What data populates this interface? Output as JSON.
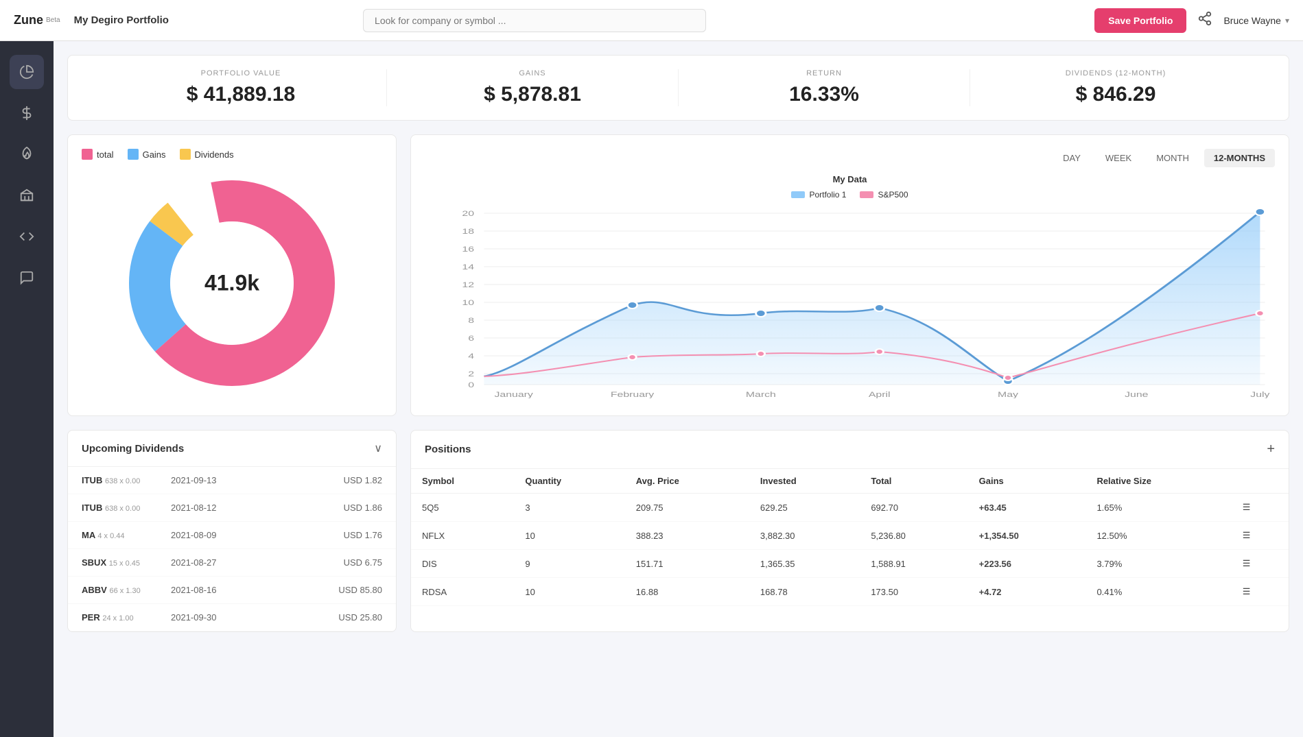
{
  "header": {
    "brand": "Zune",
    "brand_beta": "Beta",
    "title": "My Degiro Portfolio",
    "search_placeholder": "Look for company or symbol ...",
    "save_label": "Save Portfolio",
    "user_name": "Bruce Wayne"
  },
  "sidebar": {
    "items": [
      {
        "icon": "📊",
        "name": "chart-icon"
      },
      {
        "icon": "💲",
        "name": "dollar-icon"
      },
      {
        "icon": "🔥",
        "name": "fire-icon"
      },
      {
        "icon": "🏛",
        "name": "bank-icon"
      },
      {
        "icon": "< >",
        "name": "code-icon"
      },
      {
        "icon": "💬",
        "name": "chat-icon"
      }
    ]
  },
  "stats": {
    "portfolio_value_label": "PORTFOLIO VALUE",
    "portfolio_value": "$ 41,889.18",
    "gains_label": "GAINS",
    "gains_value": "$ 5,878.81",
    "return_label": "RETURN",
    "return_value": "16.33%",
    "dividends_label": "DIVIDENDS (12-MONTH)",
    "dividends_value": "$ 846.29"
  },
  "donut": {
    "center_text": "41.9k",
    "legend": [
      {
        "label": "total",
        "color": "#f06292"
      },
      {
        "label": "Gains",
        "color": "#64b5f6"
      },
      {
        "label": "Dividends",
        "color": "#f9c74f"
      }
    ]
  },
  "chart": {
    "title": "My Data",
    "time_buttons": [
      "DAY",
      "WEEK",
      "MONTH",
      "12-MONTHS"
    ],
    "active_tab": "12-MONTHS",
    "legend": [
      {
        "label": "Portfolio 1",
        "color": "#90caf9"
      },
      {
        "label": "S&P500",
        "color": "#f48fb1"
      }
    ],
    "y_labels": [
      "0",
      "2",
      "4",
      "6",
      "8",
      "10",
      "12",
      "14",
      "16",
      "18",
      "20"
    ],
    "x_labels": [
      "January",
      "February",
      "March",
      "April",
      "May",
      "June",
      "July"
    ]
  },
  "dividends": {
    "title": "Upcoming Dividends",
    "rows": [
      {
        "symbol": "ITUB",
        "sub": "638 x 0.00",
        "date": "2021-09-13",
        "amount": "USD 1.82"
      },
      {
        "symbol": "ITUB",
        "sub": "638 x 0.00",
        "date": "2021-08-12",
        "amount": "USD 1.86"
      },
      {
        "symbol": "MA",
        "sub": "4 x 0.44",
        "date": "2021-08-09",
        "amount": "USD 1.76"
      },
      {
        "symbol": "SBUX",
        "sub": "15 x 0.45",
        "date": "2021-08-27",
        "amount": "USD 6.75"
      },
      {
        "symbol": "ABBV",
        "sub": "66 x 1.30",
        "date": "2021-08-16",
        "amount": "USD 85.80"
      },
      {
        "symbol": "PER",
        "sub": "24 x 1.00",
        "date": "2021-09-30",
        "amount": "USD 25.80"
      }
    ]
  },
  "positions": {
    "title": "Positions",
    "columns": [
      "Symbol",
      "Quantity",
      "Avg. Price",
      "Invested",
      "Total",
      "Gains",
      "Relative Size"
    ],
    "rows": [
      {
        "symbol": "5Q5",
        "quantity": "3",
        "avg_price": "209.75",
        "invested": "629.25",
        "total": "692.70",
        "gains": "+63.45",
        "relative": "1.65%"
      },
      {
        "symbol": "NFLX",
        "quantity": "10",
        "avg_price": "388.23",
        "invested": "3,882.30",
        "total": "5,236.80",
        "gains": "+1,354.50",
        "relative": "12.50%"
      },
      {
        "symbol": "DIS",
        "quantity": "9",
        "avg_price": "151.71",
        "invested": "1,365.35",
        "total": "1,588.91",
        "gains": "+223.56",
        "relative": "3.79%"
      },
      {
        "symbol": "RDSA",
        "quantity": "10",
        "avg_price": "16.88",
        "invested": "168.78",
        "total": "173.50",
        "gains": "+4.72",
        "relative": "0.41%"
      }
    ]
  }
}
